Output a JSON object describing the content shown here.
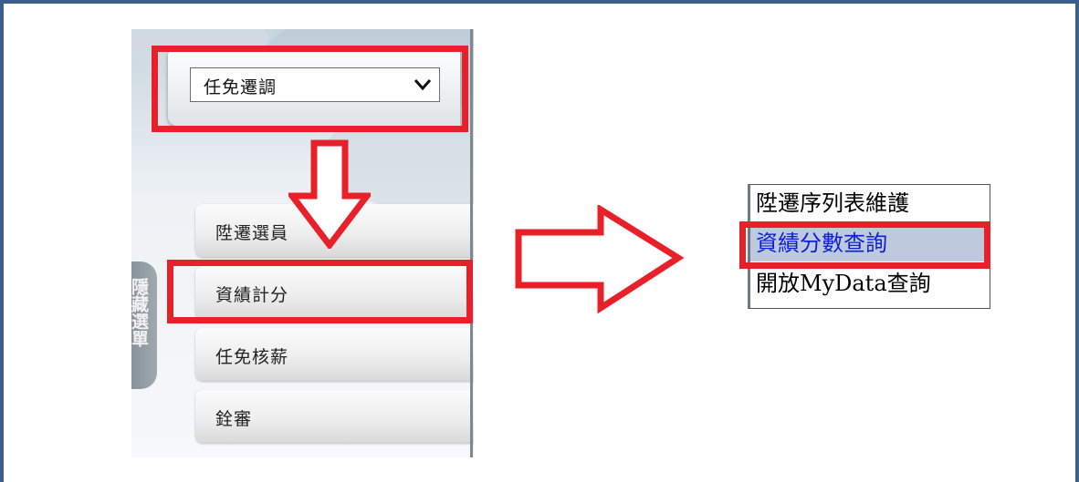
{
  "dropdown": {
    "selected_value": "任免遷調"
  },
  "nav": {
    "items": [
      {
        "label": "陞遷選員"
      },
      {
        "label": "資績計分"
      },
      {
        "label": "任免核薪"
      },
      {
        "label": "銓審"
      }
    ],
    "hidden_menu_tab": "隱藏選單"
  },
  "submenu": {
    "items": [
      {
        "label": "陞遷序列表維護"
      },
      {
        "label": "資績分數查詢"
      },
      {
        "label": "開放MyData查詢"
      }
    ],
    "selected_index": 1
  },
  "colors": {
    "highlight": "#e8202a",
    "frame": "#3a5f8f",
    "selected_text": "#0b1fd6",
    "selected_bg": "#bfc9dd"
  },
  "icons": [
    "chevron-down-icon",
    "arrow-down-icon",
    "arrow-right-icon"
  ]
}
